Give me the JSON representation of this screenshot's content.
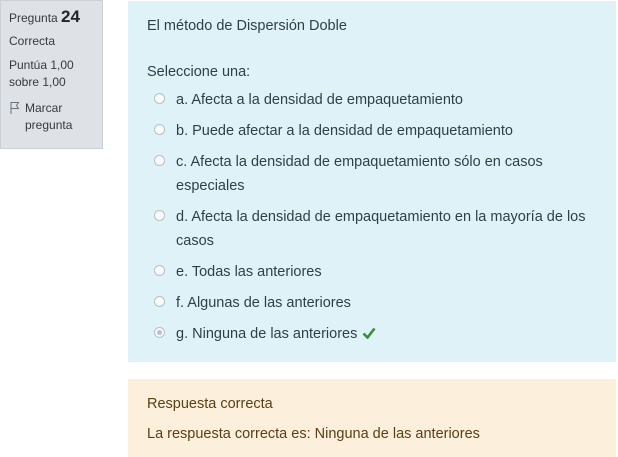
{
  "info": {
    "question_label": "Pregunta",
    "question_number": "24",
    "state": "Correcta",
    "grade_line1": "Puntúa 1,00",
    "grade_line2": "sobre 1,00",
    "flag_line1": "Marcar",
    "flag_line2": "pregunta",
    "flag_icon": "flag-icon"
  },
  "question": {
    "text": "El método de Dispersión Doble",
    "prompt": "Seleccione una:",
    "selected_index": 6,
    "options": [
      {
        "label": "a. Afecta a la densidad de empaquetamiento"
      },
      {
        "label": "b. Puede afectar a la densidad de empaquetamiento"
      },
      {
        "label": "c. Afecta la densidad de empaquetamiento sólo en casos especiales"
      },
      {
        "label": "d. Afecta la densidad de empaquetamiento en la mayoría de los casos"
      },
      {
        "label": "e. Todas las anteriores"
      },
      {
        "label": "f. Algunas de las anteriores"
      },
      {
        "label": "g. Ninguna de las anteriores",
        "correct_mark": "check-icon"
      }
    ]
  },
  "outcome": {
    "feedback": "Respuesta correcta",
    "right_answer": "La respuesta correcta es: Ninguna de las anteriores"
  },
  "colors": {
    "info_bg": "#dee2e6",
    "question_bg": "#def2f8",
    "outcome_bg": "#fcefdc",
    "correct_green": "#3a8b3a"
  }
}
